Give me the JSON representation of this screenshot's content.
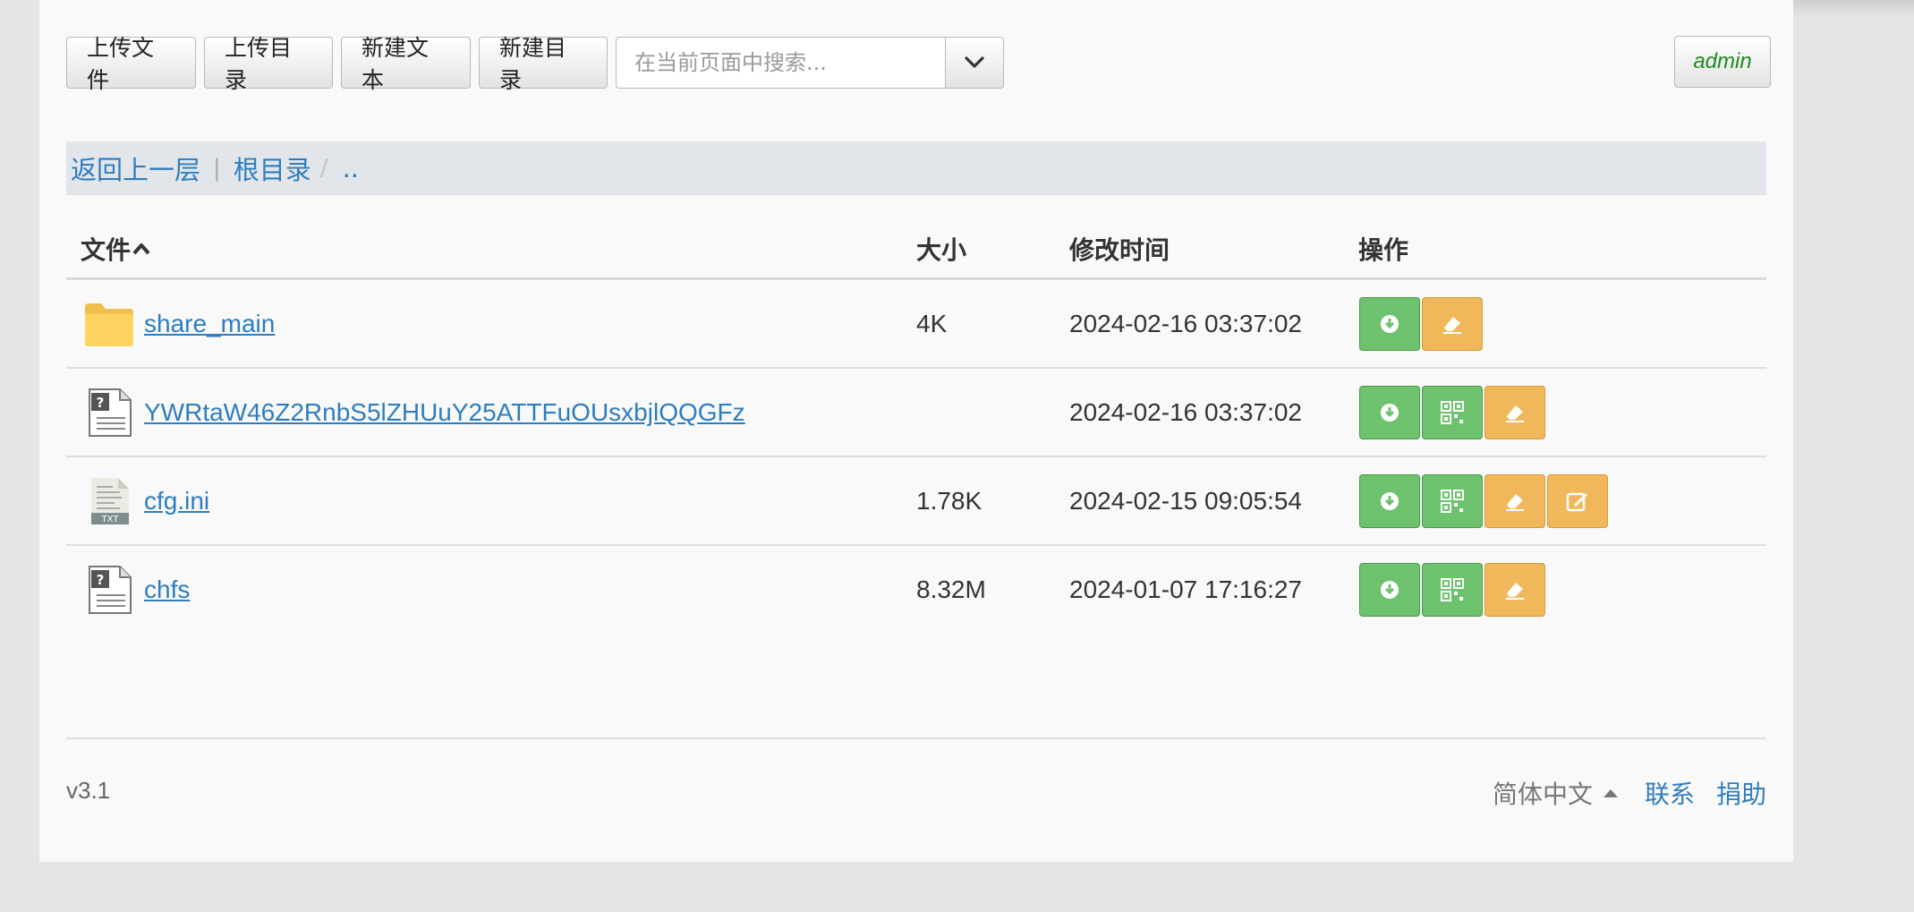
{
  "toolbar": {
    "upload_file": "上传文件",
    "upload_dir": "上传目录",
    "new_text": "新建文本",
    "new_dir": "新建目录",
    "search_placeholder": "在当前页面中搜索...",
    "user": "admin"
  },
  "breadcrumb": {
    "back": "返回上一层",
    "separator": "|",
    "root": "根目录",
    "slash": "/",
    "parent": ".."
  },
  "table": {
    "headers": {
      "name": "文件",
      "size": "大小",
      "time": "修改时间",
      "ops": "操作"
    },
    "rows": [
      {
        "name": "share_main",
        "size": "4K",
        "time": "2024-02-16 03:37:02",
        "icon": "folder-icon"
      },
      {
        "name": "YWRtaW46Z2RnbS5lZHUuY25ATTFuOUsxbjlQQGFz",
        "size": "",
        "time": "2024-02-16 03:37:02",
        "icon": "unknown-file-icon"
      },
      {
        "name": "cfg.ini",
        "size": "1.78K",
        "time": "2024-02-15 09:05:54",
        "icon": "txt-file-icon"
      },
      {
        "name": "chfs",
        "size": "8.32M",
        "time": "2024-01-07 17:16:27",
        "icon": "unknown-file-icon"
      }
    ]
  },
  "footer": {
    "version": "v3.1",
    "language": "简体中文",
    "contact": "联系",
    "donate": "捐助"
  },
  "colors": {
    "link": "#2e7dbf",
    "green_button": "#6ec26e",
    "orange_button": "#f0b85a",
    "admin_text": "#1f8a1f"
  }
}
